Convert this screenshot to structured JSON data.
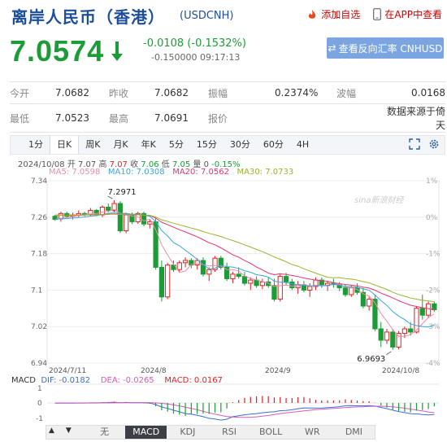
{
  "header": {
    "title": "离岸人民币（香港）",
    "code": "(USDCNH)",
    "add_watch": "添加自选",
    "in_app": "在APP中查看"
  },
  "quote": {
    "price": "7.0574",
    "change": "-0.0108 (-0.1532%)",
    "bid_line": "-0.150000 09:17:13",
    "cnh_button": "查看反向汇率 CNHUSD"
  },
  "stats": {
    "row1": [
      {
        "label": "今开",
        "value": "7.0682"
      },
      {
        "label": "昨收",
        "value": "7.0682"
      },
      {
        "label": "振幅",
        "value": "0.2374%"
      },
      {
        "label": "波幅",
        "value": "0.0168"
      }
    ],
    "row2": [
      {
        "label": "最低",
        "value": "7.0523"
      },
      {
        "label": "最高",
        "value": "7.0691"
      },
      {
        "label": "报价",
        "value": ""
      },
      {
        "label": "",
        "value": "数据来源于倚天"
      }
    ]
  },
  "tabs": [
    "1分",
    "日K",
    "周K",
    "月K",
    "年K",
    "5分",
    "15分",
    "30分",
    "60分",
    "4H"
  ],
  "active_tab": "日K",
  "ohlc": {
    "date": "2024/10/08",
    "open_label": "开",
    "open": "7.07",
    "high_label": "高",
    "high": "7.07",
    "close_label": "收",
    "close": "7.06",
    "low_label": "低",
    "low": "7.05",
    "vol_label": "量",
    "vol": "0",
    "pct": "-0.15%"
  },
  "ma": [
    {
      "label": "MA5: 7.0598",
      "color": "#f08ca8"
    },
    {
      "label": "MA10: 7.0308",
      "color": "#3aa6e0"
    },
    {
      "label": "MA20: 7.0562",
      "color": "#e8346e"
    },
    {
      "label": "MA30: 7.0733",
      "color": "#9ab52c"
    }
  ],
  "macd_label": {
    "name": "MACD",
    "dif": "DIF: -0.0182",
    "dea": "DEA: -0.0265",
    "macd": "MACD: 0.0167"
  },
  "bottom_tabs": [
    "无",
    "MACD",
    "KDJ",
    "RSI",
    "BOLL",
    "WR",
    "DMI"
  ],
  "active_bottom_tab": "MACD",
  "watermark": "sina新浪财经",
  "chart_data": {
    "type": "candlestick",
    "y_ticks": [
      "7.34",
      "7.26",
      "7.18",
      "7.1",
      "7.02",
      "6.94"
    ],
    "y_range": [
      6.94,
      7.34
    ],
    "pct_ticks": [
      "1%",
      "0%",
      "-1%",
      "-2%",
      "-3%",
      "-4%"
    ],
    "x_ticks": [
      "2024/7/11",
      "2024/8",
      "2024/9",
      "2024/10/8"
    ],
    "max_label": "7.2971",
    "min_label": "6.9693",
    "macd_ticks": [
      "1",
      "0",
      "-1"
    ],
    "candles": [
      [
        7.262,
        7.265,
        7.252,
        7.255
      ],
      [
        7.256,
        7.272,
        7.25,
        7.268
      ],
      [
        7.268,
        7.272,
        7.258,
        7.262
      ],
      [
        7.262,
        7.27,
        7.255,
        7.265
      ],
      [
        7.265,
        7.275,
        7.26,
        7.268
      ],
      [
        7.268,
        7.272,
        7.262,
        7.266
      ],
      [
        7.266,
        7.28,
        7.262,
        7.275
      ],
      [
        7.275,
        7.278,
        7.262,
        7.265
      ],
      [
        7.265,
        7.286,
        7.26,
        7.282
      ],
      [
        7.282,
        7.29,
        7.27,
        7.275
      ],
      [
        7.275,
        7.297,
        7.27,
        7.29
      ],
      [
        7.29,
        7.295,
        7.225,
        7.23
      ],
      [
        7.23,
        7.27,
        7.225,
        7.265
      ],
      [
        7.265,
        7.27,
        7.245,
        7.25
      ],
      [
        7.25,
        7.272,
        7.245,
        7.268
      ],
      [
        7.268,
        7.272,
        7.24,
        7.245
      ],
      [
        7.245,
        7.255,
        7.235,
        7.25
      ],
      [
        7.25,
        7.258,
        7.145,
        7.15
      ],
      [
        7.15,
        7.165,
        7.075,
        7.085
      ],
      [
        7.085,
        7.16,
        7.08,
        7.155
      ],
      [
        7.155,
        7.165,
        7.14,
        7.145
      ],
      [
        7.145,
        7.165,
        7.138,
        7.16
      ],
      [
        7.16,
        7.172,
        7.15,
        7.165
      ],
      [
        7.165,
        7.17,
        7.148,
        7.155
      ],
      [
        7.155,
        7.17,
        7.145,
        7.165
      ],
      [
        7.165,
        7.172,
        7.13,
        7.135
      ],
      [
        7.135,
        7.15,
        7.12,
        7.145
      ],
      [
        7.145,
        7.175,
        7.14,
        7.17
      ],
      [
        7.17,
        7.175,
        7.145,
        7.15
      ],
      [
        7.15,
        7.16,
        7.12,
        7.125
      ],
      [
        7.125,
        7.14,
        7.115,
        7.135
      ],
      [
        7.135,
        7.15,
        7.125,
        7.13
      ],
      [
        7.13,
        7.14,
        7.11,
        7.115
      ],
      [
        7.115,
        7.128,
        7.1,
        7.122
      ],
      [
        7.122,
        7.13,
        7.105,
        7.11
      ],
      [
        7.11,
        7.125,
        7.102,
        7.118
      ],
      [
        7.118,
        7.128,
        7.105,
        7.11
      ],
      [
        7.11,
        7.125,
        7.075,
        7.08
      ],
      [
        7.08,
        7.135,
        7.075,
        7.13
      ],
      [
        7.13,
        7.138,
        7.11,
        7.118
      ],
      [
        7.118,
        7.125,
        7.1,
        7.105
      ],
      [
        7.105,
        7.12,
        7.092,
        7.112
      ],
      [
        7.112,
        7.12,
        7.095,
        7.1
      ],
      [
        7.1,
        7.115,
        7.085,
        7.108
      ],
      [
        7.108,
        7.128,
        7.1,
        7.122
      ],
      [
        7.122,
        7.128,
        7.105,
        7.11
      ],
      [
        7.11,
        7.12,
        7.098,
        7.115
      ],
      [
        7.115,
        7.125,
        7.105,
        7.112
      ],
      [
        7.112,
        7.118,
        7.098,
        7.105
      ],
      [
        7.105,
        7.112,
        7.085,
        7.09
      ],
      [
        7.09,
        7.11,
        7.085,
        7.105
      ],
      [
        7.105,
        7.115,
        7.09,
        7.095
      ],
      [
        7.095,
        7.105,
        7.06,
        7.065
      ],
      [
        7.065,
        7.085,
        7.055,
        7.08
      ],
      [
        7.08,
        7.09,
        7.01,
        7.015
      ],
      [
        7.015,
        7.03,
        6.975,
        6.99
      ],
      [
        6.99,
        7.015,
        6.982,
        7.008
      ],
      [
        7.008,
        7.015,
        6.969,
        6.975
      ],
      [
        6.975,
        7.01,
        6.97,
        7.005
      ],
      [
        7.005,
        7.02,
        6.995,
        7.015
      ],
      [
        7.015,
        7.03,
        7.0,
        7.008
      ],
      [
        7.008,
        7.065,
        7.005,
        7.06
      ],
      [
        7.06,
        7.09,
        7.035,
        7.045
      ],
      [
        7.045,
        7.075,
        7.04,
        7.07
      ],
      [
        7.07,
        7.075,
        7.052,
        7.057
      ]
    ]
  }
}
